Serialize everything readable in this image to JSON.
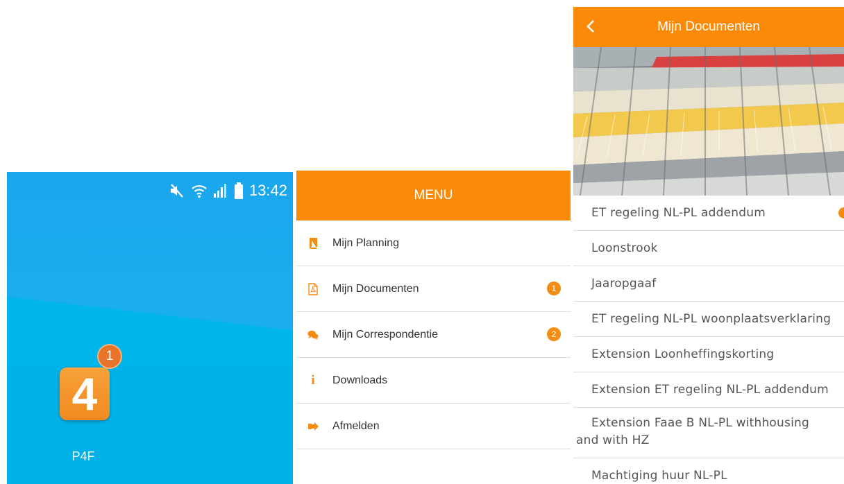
{
  "phone": {
    "status_time": "13:42",
    "app": {
      "label": "P4F",
      "icon_glyph": "4",
      "badge": "1"
    }
  },
  "menu": {
    "title": "MENU",
    "items": [
      {
        "label": "Mijn Planning",
        "icon": "book-icon",
        "badge": ""
      },
      {
        "label": "Mijn Documenten",
        "icon": "pdf-file-icon",
        "badge": "1"
      },
      {
        "label": "Mijn Correspondentie",
        "icon": "chat-bubbles-icon",
        "badge": "2"
      },
      {
        "label": "Downloads",
        "icon": "info-icon",
        "badge": ""
      },
      {
        "label": "Afmelden",
        "icon": "sign-out-icon",
        "badge": ""
      }
    ]
  },
  "documents": {
    "title": "Mijn Documenten",
    "items": [
      {
        "label": "ET regeling NL-PL addendum",
        "unread": true
      },
      {
        "label": "Loonstrook"
      },
      {
        "label": "Jaaropgaaf"
      },
      {
        "label": "ET regeling NL-PL woonplaatsverklaring"
      },
      {
        "label": "Extension Loonheffingskorting"
      },
      {
        "label": "Extension ET regeling NL-PL addendum"
      },
      {
        "label": "Extension Faae B NL-PL withhousing and with HZ"
      },
      {
        "label": "Machtiging huur NL-PL"
      }
    ]
  },
  "colors": {
    "accent": "#fb8a08",
    "badge": "#f28c13",
    "phone_bg": "#19b7f0"
  }
}
